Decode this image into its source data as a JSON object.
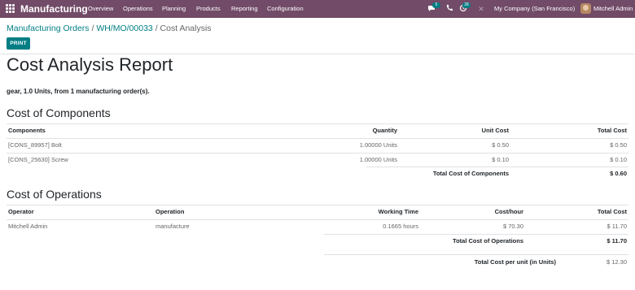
{
  "navbar": {
    "app_name": "Manufacturing",
    "menu": [
      "Overview",
      "Operations",
      "Planning",
      "Products",
      "Reporting",
      "Configuration"
    ],
    "chat_badge": "5",
    "activity_badge": "28",
    "company": "My Company (San Francisco)",
    "user": "Mitchell Admin",
    "colors": {
      "navbar": "#714b67",
      "accent": "#017e84"
    }
  },
  "breadcrumb": {
    "root": "Manufacturing Orders",
    "order": "WH/MO/00033",
    "current": "Cost Analysis"
  },
  "controls": {
    "print_label": "PRINT"
  },
  "report": {
    "title": "Cost Analysis Report",
    "summary": "gear, 1.0 Units, from 1 manufacturing order(s).",
    "components": {
      "title": "Cost of Components",
      "headers": [
        "Components",
        "Quantity",
        "Unit Cost",
        "Total Cost"
      ],
      "rows": [
        [
          "[CONS_89957] Bolt",
          "1.00000 Units",
          "$ 0.50",
          "$ 0.50"
        ],
        [
          "[CONS_25630] Screw",
          "1.00000 Units",
          "$ 0.10",
          "$ 0.10"
        ]
      ],
      "total_label": "Total Cost of Components",
      "total_value": "$ 0.60"
    },
    "operations": {
      "title": "Cost of Operations",
      "headers": [
        "Operator",
        "Operation",
        "Working Time",
        "Cost/hour",
        "Total Cost"
      ],
      "rows": [
        [
          "Mitchell Admin",
          "manufacture",
          "0.1665 hours",
          "$ 70.30",
          "$ 11.70"
        ]
      ],
      "total_label": "Total Cost of Operations",
      "total_value": "$ 11.70"
    },
    "unit_cost": {
      "label": "Total Cost per unit (in Units)",
      "value": "$ 12.30"
    }
  }
}
